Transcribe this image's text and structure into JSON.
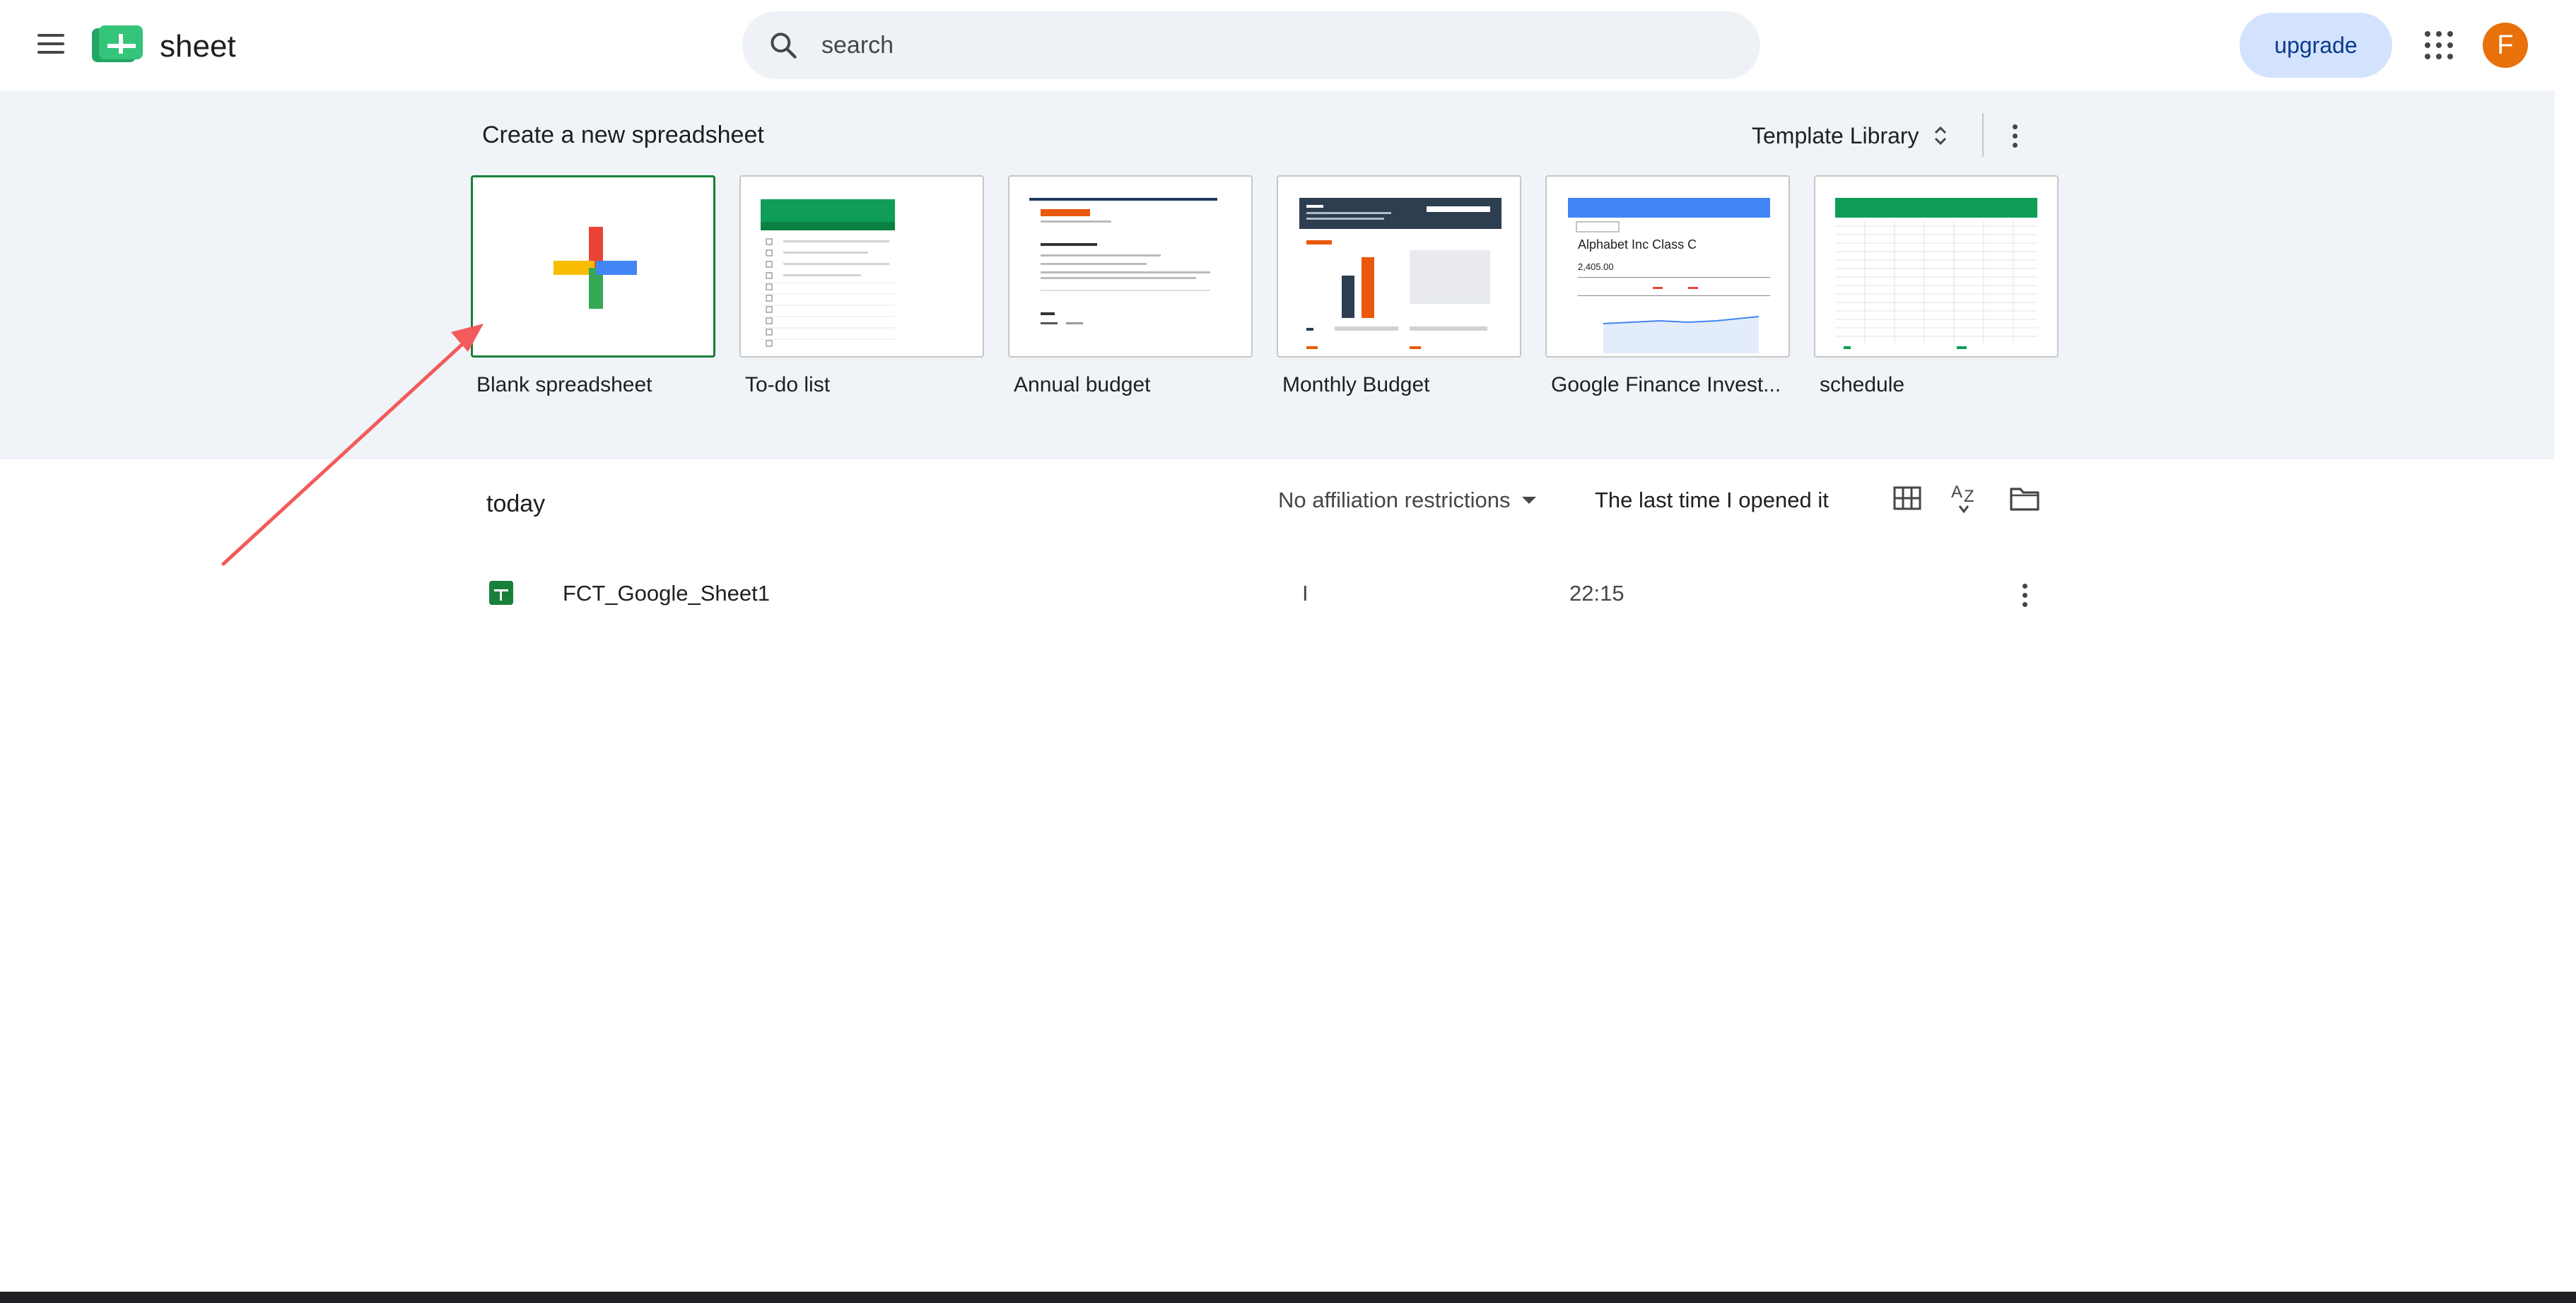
{
  "header": {
    "app_name": "sheet",
    "search_placeholder": "search",
    "upgrade_label": "upgrade",
    "avatar_initial": "F",
    "avatar_color": "#e8710a"
  },
  "templates": {
    "title": "Create a new spreadsheet",
    "library_label": "Template Library",
    "items": [
      {
        "label": "Blank spreadsheet"
      },
      {
        "label": "To-do list"
      },
      {
        "label": "Annual budget"
      },
      {
        "label": "Monthly Budget"
      },
      {
        "label": "Google Finance Invest..."
      },
      {
        "label": "schedule"
      }
    ],
    "finance_thumb_title": "Alphabet Inc Class C",
    "finance_thumb_value": "2,405.00"
  },
  "files": {
    "section_label": "today",
    "owner_filter": "No affiliation restrictions",
    "sort_label": "The last time I opened it",
    "rows": [
      {
        "name": "FCT_Google_Sheet1",
        "owner": "I",
        "time": "22:15"
      }
    ]
  },
  "colors": {
    "accent_green": "#188038",
    "strip_bg": "#f0f4f9",
    "upgrade_bg": "#d3e3fd"
  }
}
